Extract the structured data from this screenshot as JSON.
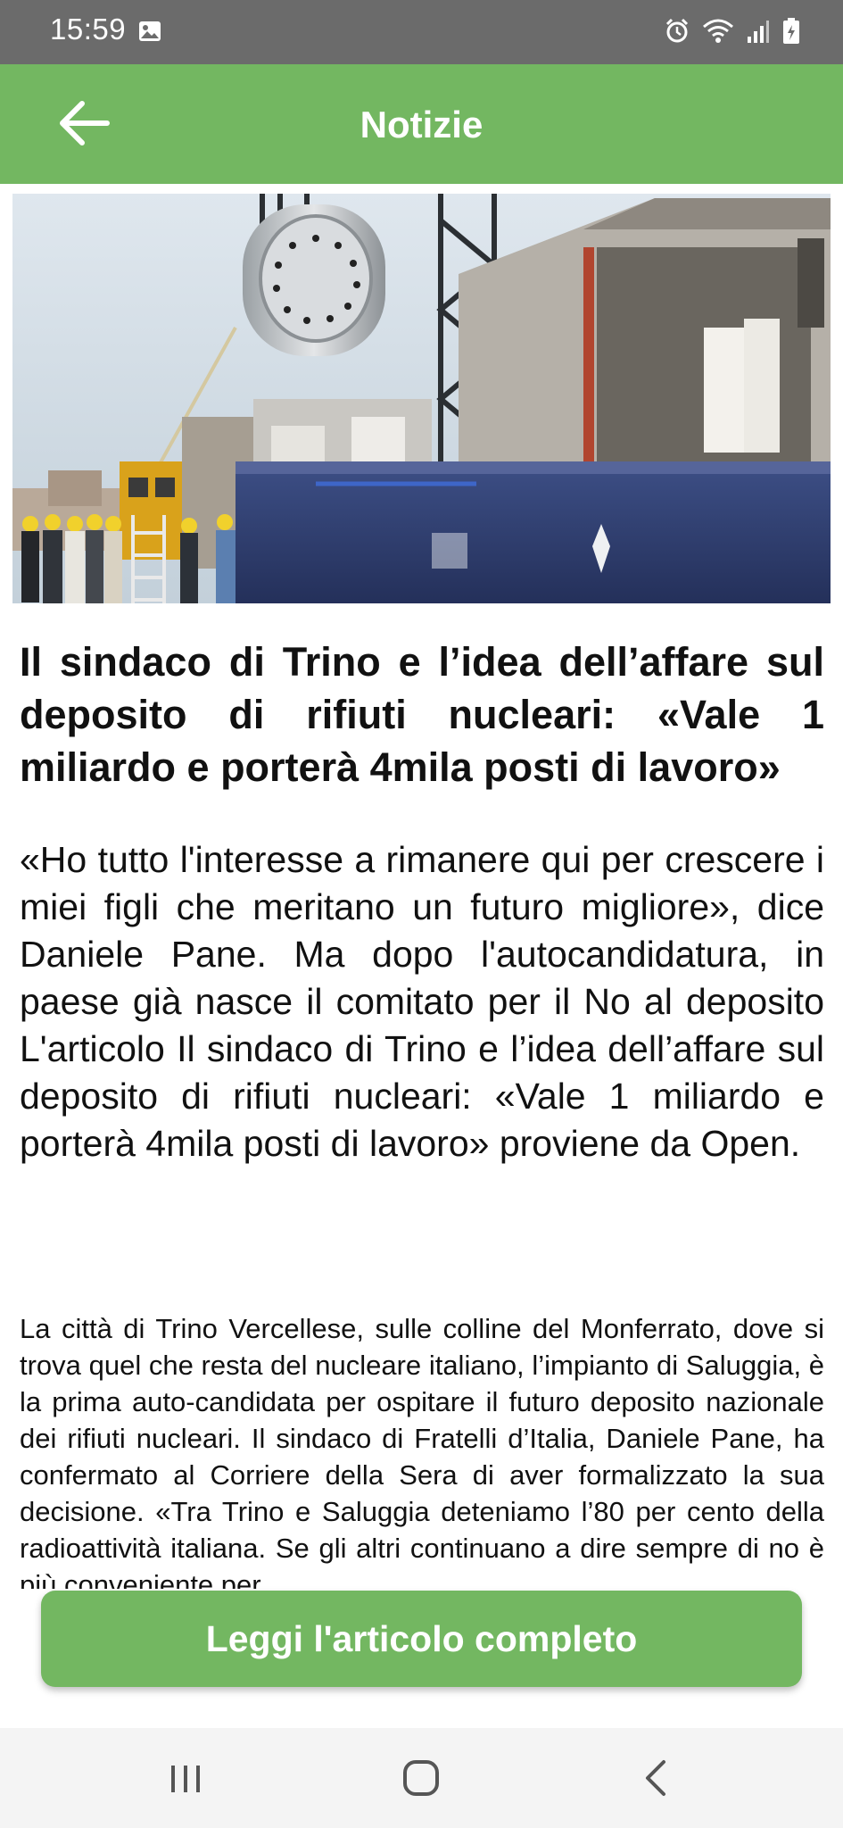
{
  "status_bar": {
    "time": "15:59",
    "left_icons": [
      "gallery-icon"
    ],
    "right_icons": [
      "alarm-icon",
      "wifi-icon",
      "signal-icon",
      "battery-icon"
    ]
  },
  "app_bar": {
    "title": "Notizie",
    "back_icon": "arrow-left-icon",
    "color": "#73b761"
  },
  "article": {
    "image_alt": "Cask being loaded onto rail wagon with workers in hard hats",
    "title": "Il sindaco di Trino e l’idea dell’affare sul deposito di rifiuti nucleari: «Vale 1 miliardo e porterà 4mila posti di lavoro»",
    "lead": "«Ho tutto l'interesse a rimanere qui per crescere i miei figli che meritano un futuro migliore», dice Daniele Pane. Ma dopo l'autocandidatura, in paese già nasce il comitato per il No al deposito L'articolo Il sindaco di Trino e l’idea dell’affare sul deposito di rifiuti nucleari: «Vale 1 miliardo e porterà 4mila posti di lavoro» proviene da Open.",
    "body": "La città di Trino Vercellese, sulle colline del Monferrato, dove si trova quel che resta del nucleare italiano, l’impianto di Saluggia, è la prima auto-candidata per ospitare il futuro deposito nazionale dei rifiuti nucleari. Il sindaco di Fratelli d’Italia, Daniele Pane, ha confermato al Corriere della Sera di aver formalizzato la sua decisione. «Tra Trino e Saluggia deteniamo l’80 per cento della radioattività italiana. Se gli altri continuano a dire sempre di no è più conveniente per"
  },
  "cta": {
    "label": "Leggi l'articolo completo"
  },
  "nav_bar": {
    "buttons": [
      "recent-apps-icon",
      "home-icon",
      "back-icon"
    ]
  }
}
